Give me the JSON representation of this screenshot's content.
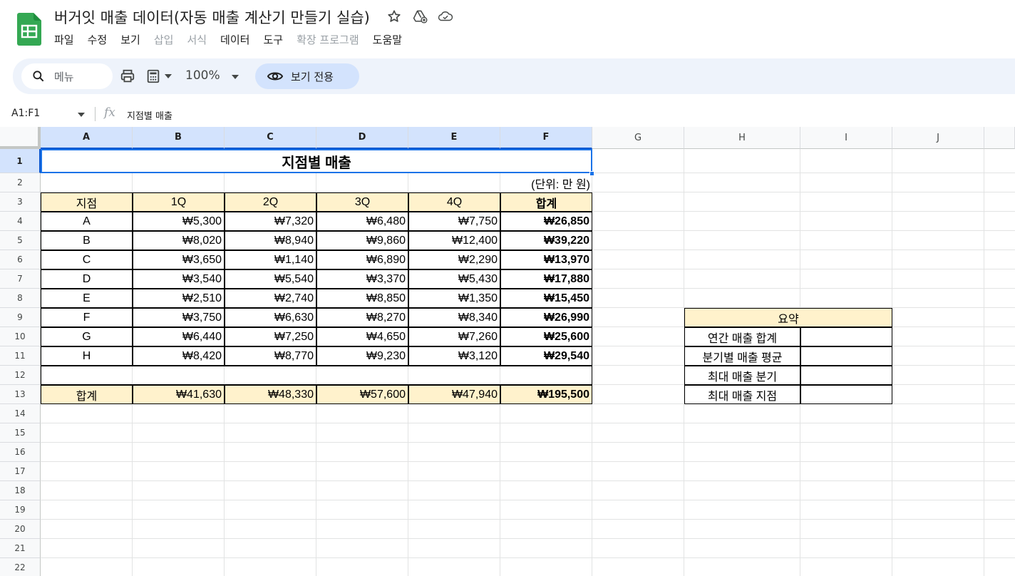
{
  "app": {
    "doc_title": "버거잇 매출 데이터(자동 매출 계산기 만들기 실습)",
    "menu": [
      {
        "label": "파일",
        "enabled": true
      },
      {
        "label": "수정",
        "enabled": true
      },
      {
        "label": "보기",
        "enabled": true
      },
      {
        "label": "삽입",
        "enabled": false
      },
      {
        "label": "서식",
        "enabled": false
      },
      {
        "label": "데이터",
        "enabled": true
      },
      {
        "label": "도구",
        "enabled": true
      },
      {
        "label": "확장 프로그램",
        "enabled": false
      },
      {
        "label": "도움말",
        "enabled": true
      }
    ],
    "accent_color": "#0b57d0",
    "logo_color": "#34a853"
  },
  "toolbar": {
    "menu_search_label": "메뉴",
    "zoom": "100%",
    "view_only_label": "보기 전용"
  },
  "formula_bar": {
    "namebox": "A1:F1",
    "fx_label": "fx",
    "content": "지점별 매출"
  },
  "columns": [
    "A",
    "B",
    "C",
    "D",
    "E",
    "F",
    "G",
    "H",
    "I",
    "J"
  ],
  "rows": [
    "1",
    "2",
    "3",
    "4",
    "5",
    "6",
    "7",
    "8",
    "9",
    "10",
    "11",
    "12",
    "13",
    "14",
    "15",
    "16",
    "17",
    "18",
    "19",
    "20",
    "21",
    "22"
  ],
  "sheet": {
    "title": "지점별 매출",
    "unit_note": "(단위: 만 원)",
    "headers": [
      "지점",
      "1Q",
      "2Q",
      "3Q",
      "4Q",
      "합계"
    ],
    "branches": [
      {
        "name": "A",
        "q": [
          "₩5,300",
          "₩7,320",
          "₩6,480",
          "₩7,750"
        ],
        "total": "₩26,850"
      },
      {
        "name": "B",
        "q": [
          "₩8,020",
          "₩8,940",
          "₩9,860",
          "₩12,400"
        ],
        "total": "₩39,220"
      },
      {
        "name": "C",
        "q": [
          "₩3,650",
          "₩1,140",
          "₩6,890",
          "₩2,290"
        ],
        "total": "₩13,970"
      },
      {
        "name": "D",
        "q": [
          "₩3,540",
          "₩5,540",
          "₩3,370",
          "₩5,430"
        ],
        "total": "₩17,880"
      },
      {
        "name": "E",
        "q": [
          "₩2,510",
          "₩2,740",
          "₩8,850",
          "₩1,350"
        ],
        "total": "₩15,450"
      },
      {
        "name": "F",
        "q": [
          "₩3,750",
          "₩6,630",
          "₩8,270",
          "₩8,340"
        ],
        "total": "₩26,990"
      },
      {
        "name": "G",
        "q": [
          "₩6,440",
          "₩7,250",
          "₩4,650",
          "₩7,260"
        ],
        "total": "₩25,600"
      },
      {
        "name": "H",
        "q": [
          "₩8,420",
          "₩8,770",
          "₩9,230",
          "₩3,120"
        ],
        "total": "₩29,540"
      }
    ],
    "totals": {
      "label": "합계",
      "q": [
        "₩41,630",
        "₩48,330",
        "₩57,600",
        "₩47,940"
      ],
      "total": "₩195,500"
    },
    "summary": {
      "title": "요약",
      "items": [
        "연간 매출 합계",
        "분기별 매출 평균",
        "최대 매출 분기",
        "최대 매출 지점"
      ]
    },
    "header_fill": "#fff2cc"
  }
}
